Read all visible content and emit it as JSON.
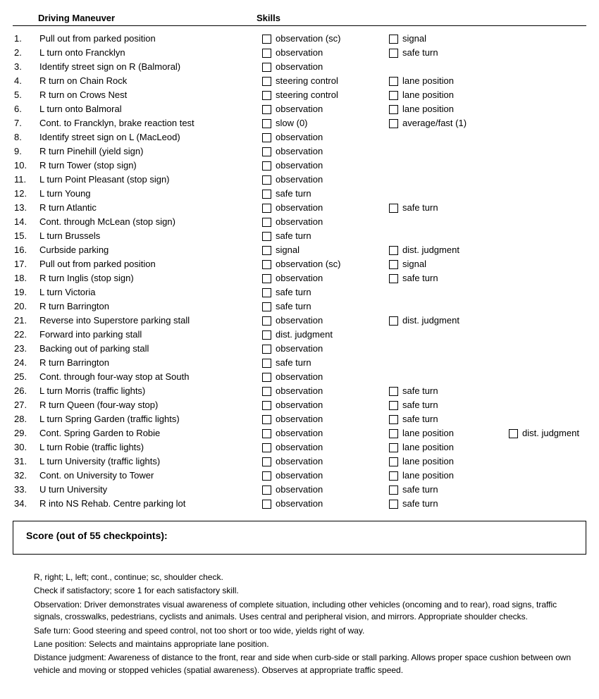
{
  "header": {
    "maneuver": "Driving Maneuver",
    "skills": "Skills"
  },
  "rows": [
    {
      "n": "1.",
      "m": "Pull out from parked position",
      "s": [
        "observation (sc)",
        "signal"
      ]
    },
    {
      "n": "2.",
      "m": "L turn onto Francklyn",
      "s": [
        "observation",
        "safe turn"
      ]
    },
    {
      "n": "3.",
      "m": "Identify street sign on R (Balmoral)",
      "s": [
        "observation"
      ]
    },
    {
      "n": "4.",
      "m": "R turn on Chain Rock",
      "s": [
        "steering control",
        "lane position"
      ]
    },
    {
      "n": "5.",
      "m": "R turn on Crows Nest",
      "s": [
        "steering control",
        "lane position"
      ]
    },
    {
      "n": "6.",
      "m": "L turn onto Balmoral",
      "s": [
        "observation",
        "lane position"
      ]
    },
    {
      "n": "7.",
      "m": "Cont. to Francklyn, brake reaction test",
      "s": [
        "slow (0)",
        "average/fast (1)"
      ]
    },
    {
      "n": "8.",
      "m": "Identify street sign on L (MacLeod)",
      "s": [
        "observation"
      ]
    },
    {
      "n": "9.",
      "m": "R turn Pinehill (yield sign)",
      "s": [
        "observation"
      ]
    },
    {
      "n": "10.",
      "m": "R turn Tower (stop sign)",
      "s": [
        "observation"
      ]
    },
    {
      "n": "11.",
      "m": "L turn Point Pleasant (stop sign)",
      "s": [
        "observation"
      ]
    },
    {
      "n": "12.",
      "m": "L turn Young",
      "s": [
        "safe turn"
      ]
    },
    {
      "n": "13.",
      "m": "R turn Atlantic",
      "s": [
        "observation",
        "safe turn"
      ]
    },
    {
      "n": "14.",
      "m": "Cont. through McLean (stop sign)",
      "s": [
        "observation"
      ]
    },
    {
      "n": "15.",
      "m": "L turn Brussels",
      "s": [
        "safe turn"
      ]
    },
    {
      "n": "16.",
      "m": "Curbside parking",
      "s": [
        "signal",
        "dist. judgment"
      ]
    },
    {
      "n": "17.",
      "m": "Pull out from parked position",
      "s": [
        "observation (sc)",
        "signal"
      ]
    },
    {
      "n": "18.",
      "m": "R turn Inglis (stop sign)",
      "s": [
        "observation",
        "safe turn"
      ]
    },
    {
      "n": "19.",
      "m": "L turn Victoria",
      "s": [
        "safe turn"
      ]
    },
    {
      "n": "20.",
      "m": "R turn Barrington",
      "s": [
        "safe turn"
      ]
    },
    {
      "n": "21.",
      "m": "Reverse into Superstore parking stall",
      "s": [
        "observation",
        "dist. judgment"
      ]
    },
    {
      "n": "22.",
      "m": "Forward into parking stall",
      "s": [
        "dist. judgment"
      ]
    },
    {
      "n": "23.",
      "m": "Backing out of parking stall",
      "s": [
        "observation"
      ]
    },
    {
      "n": "24.",
      "m": "R turn Barrington",
      "s": [
        "safe turn"
      ]
    },
    {
      "n": "25.",
      "m": "Cont. through four-way stop at South",
      "s": [
        "observation"
      ]
    },
    {
      "n": "26.",
      "m": "L turn Morris (traffic lights)",
      "s": [
        "observation",
        "safe turn"
      ]
    },
    {
      "n": "27.",
      "m": "R turn Queen (four-way stop)",
      "s": [
        "observation",
        "safe turn"
      ]
    },
    {
      "n": "28.",
      "m": "L turn Spring Garden (traffic lights)",
      "s": [
        "observation",
        "safe turn"
      ]
    },
    {
      "n": "29.",
      "m": "Cont. Spring Garden to Robie",
      "s": [
        "observation",
        "lane position",
        "dist. judgment"
      ]
    },
    {
      "n": "30.",
      "m": "L turn Robie (traffic lights)",
      "s": [
        "observation",
        "lane position"
      ]
    },
    {
      "n": "31.",
      "m": "L turn University (traffic lights)",
      "s": [
        "observation",
        "lane position"
      ]
    },
    {
      "n": "32.",
      "m": "Cont. on University to Tower",
      "s": [
        "observation",
        "lane position"
      ]
    },
    {
      "n": "33.",
      "m": "U turn University",
      "s": [
        "observation",
        "safe turn"
      ]
    },
    {
      "n": "34.",
      "m": "R into NS Rehab. Centre parking lot",
      "s": [
        "observation",
        "safe turn"
      ]
    }
  ],
  "score_label": "Score (out of 55 checkpoints):",
  "notes": [
    "R, right; L, left; cont., continue; sc, shoulder check.",
    "Check if satisfactory; score 1 for each satisfactory skill.",
    "Observation: Driver demonstrates visual awareness of complete situation, including other vehicles (oncoming and to rear), road signs, traffic signals, crosswalks, pedestrians, cyclists and animals. Uses central and peripheral vision, and mirrors. Appropriate shoulder checks.",
    "Safe turn: Good steering and speed control, not too short or too wide, yields right of way.",
    "Lane position: Selects and maintains appropriate lane position.",
    "Distance judgment: Awareness of distance to the front, rear and side when curb-side or stall parking. Allows proper space cushion between own vehicle and moving or stopped vehicles (spatial awareness). Observes at appropriate traffic speed."
  ]
}
